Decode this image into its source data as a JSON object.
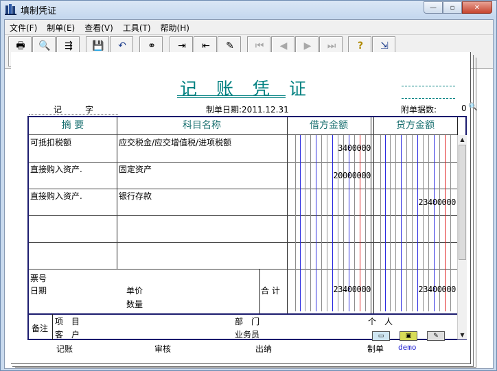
{
  "window": {
    "title": "填制凭证"
  },
  "menu": [
    {
      "label": "文件(F)"
    },
    {
      "label": "制单(E)"
    },
    {
      "label": "查看(V)"
    },
    {
      "label": "工具(T)"
    },
    {
      "label": "帮助(H)"
    }
  ],
  "toolbar": {
    "print": "打印",
    "preview": "预览",
    "export": "输出",
    "save": "保存",
    "discard": "放弃",
    "query": "查询",
    "insert": "插分",
    "delete": "删分",
    "flow": "流量",
    "first": "首张",
    "prev": "上张",
    "next": "下张",
    "last": "末张",
    "help": "帮助",
    "exit": "退出"
  },
  "voucher": {
    "title": "记 账 凭 证",
    "type_label": "记字",
    "date": "制单日期:2011.12.31",
    "attachments_label": "附单据数:",
    "attachments_count": "0",
    "headers": {
      "summary": "摘 要",
      "account": "科目名称",
      "debit": "借方金额",
      "credit": "贷方金额"
    },
    "rows": [
      {
        "summary": "可抵扣税额",
        "account": "应交税金/应交增值税/进项税额",
        "debit": "3400000",
        "credit": ""
      },
      {
        "summary": "直接购入资产.",
        "account": "固定资产",
        "debit": "20000000",
        "credit": ""
      },
      {
        "summary": "直接购入资产.",
        "account": "银行存款",
        "debit": "",
        "credit": "23400000"
      },
      {
        "summary": "",
        "account": "",
        "debit": "",
        "credit": ""
      },
      {
        "summary": "",
        "account": "",
        "debit": "",
        "credit": ""
      }
    ],
    "footer": {
      "ticket_no": "票号",
      "date": "日期",
      "unit_price": "单价",
      "quantity": "数量",
      "total_label": "合 计",
      "total_debit": "23400000",
      "total_credit": "23400000"
    },
    "notes": {
      "label": "备注",
      "project": "项　目",
      "department": "部　门",
      "person": "个　人",
      "customer": "客　户",
      "salesperson": "业务员"
    },
    "signatures": {
      "bookkeeping": "记账",
      "review": "审核",
      "cashier": "出纳",
      "maker": "制单",
      "maker_name": "demo"
    }
  }
}
